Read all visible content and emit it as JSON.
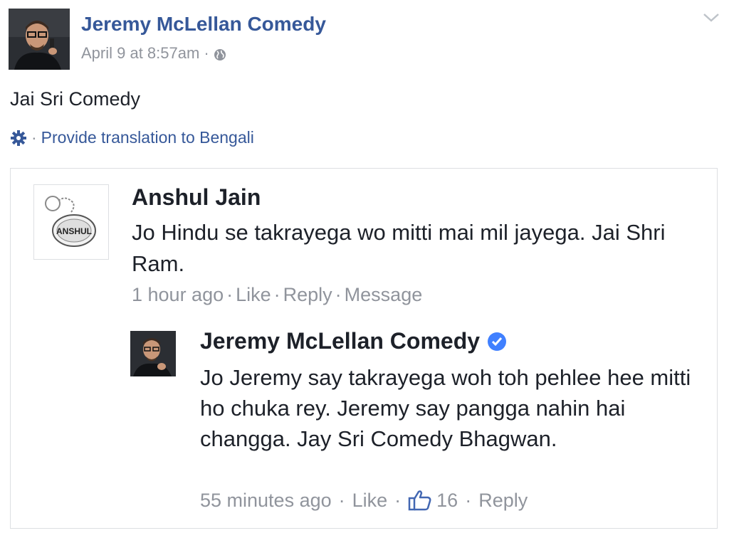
{
  "post": {
    "page_name": "Jeremy McLellan Comedy",
    "timestamp": "April 9 at 8:57am",
    "separator": "·",
    "audience_icon": "globe-icon",
    "text": "Jai Sri Comedy",
    "translate_link": "Provide translation to Bengali",
    "translate_icon": "gear-icon",
    "menu_icon": "chevron-down-icon"
  },
  "comment": {
    "author": "Anshul Jain",
    "avatar_text": "ANSHUL",
    "text": "Jo Hindu se takrayega wo mitti mai mil jayega. Jai Shri Ram.",
    "time": "1 hour ago",
    "like": "Like",
    "reply": "Reply",
    "message": "Message"
  },
  "reply": {
    "author": "Jeremy McLellan Comedy",
    "verified_icon": "verified-badge-icon",
    "text": "Jo Jeremy say takrayega woh toh pehlee hee mitti ho chuka rey. Jeremy say pangga nahin hai changga. Jay Sri Comedy Bhagwan.",
    "time": "55 minutes ago",
    "like": "Like",
    "like_icon": "thumbs-up-icon",
    "like_count": "16",
    "reply_label": "Reply"
  },
  "colors": {
    "link_blue": "#365899",
    "meta_gray": "#90949c",
    "text": "#1d2129",
    "verified_blue": "#4080ff",
    "border": "#dddfe2"
  }
}
